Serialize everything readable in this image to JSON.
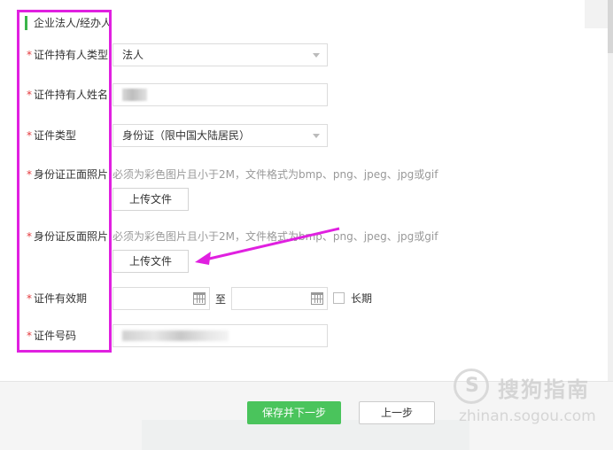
{
  "section": {
    "title": "企业法人/经办人"
  },
  "form": {
    "holder_type": {
      "label": "证件持有人类型",
      "value": "法人"
    },
    "holder_name": {
      "label": "证件持有人姓名"
    },
    "id_type": {
      "label": "证件类型",
      "value": "身份证（限中国大陆居民）"
    },
    "id_front": {
      "label": "身份证正面照片",
      "hint": "必须为彩色图片且小于2M，文件格式为bmp、png、jpeg、jpg或gif",
      "button": "上传文件"
    },
    "id_back": {
      "label": "身份证反面照片",
      "hint": "必须为彩色图片且小于2M，文件格式为bmp、png、jpeg、jpg或gif",
      "button": "上传文件"
    },
    "validity": {
      "label": "证件有效期",
      "to": "至",
      "long_term": "长期"
    },
    "id_number": {
      "label": "证件号码"
    },
    "required_mark": "*"
  },
  "footer": {
    "save_next": "保存并下一步",
    "previous": "上一步"
  },
  "watermark": {
    "logo": "S",
    "text": "搜狗指南",
    "url": "zhinan.sogou.com"
  },
  "colors": {
    "accent": "#4ac45c",
    "required": "#e4393c",
    "annotation": "#e020e0"
  }
}
